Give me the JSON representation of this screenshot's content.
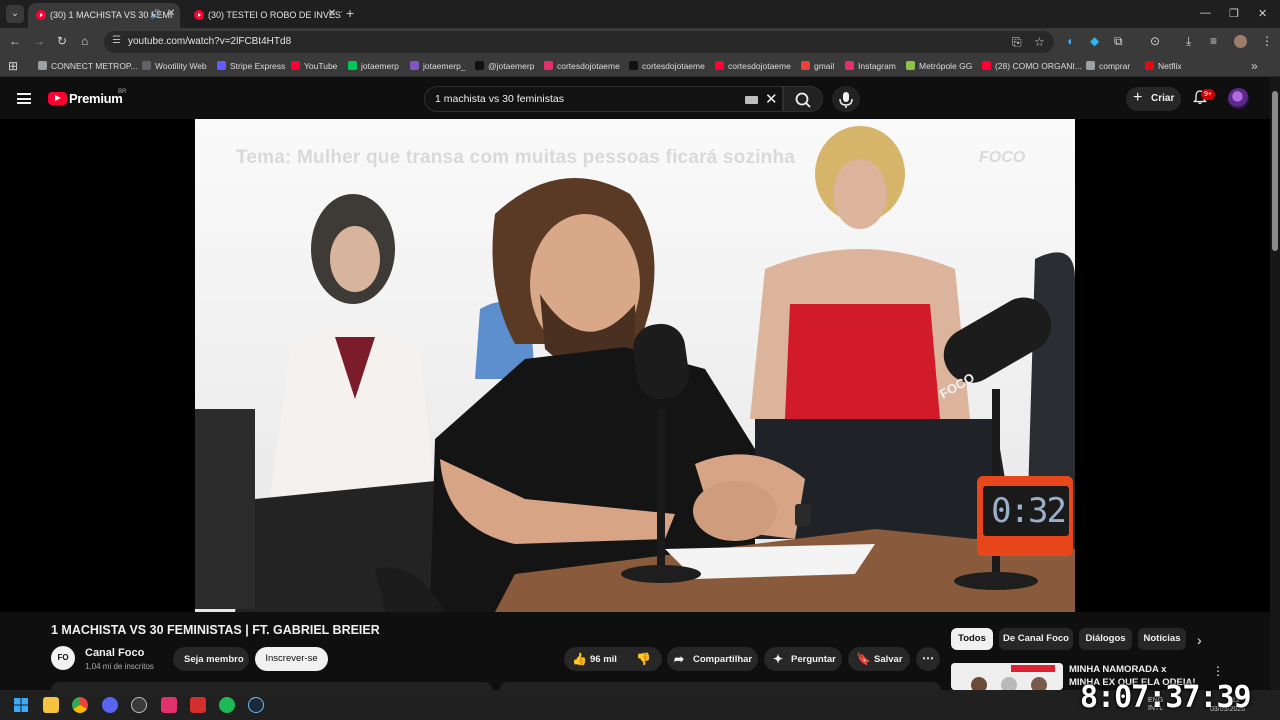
{
  "browser": {
    "tabs": [
      {
        "title": "(30) 1 MACHISTA VS 30 FEMI",
        "active": true
      },
      {
        "title": "(30) TESTEI O ROBO DE INVEST",
        "active": false
      }
    ],
    "url": "youtube.com/watch?v=2lFCBt4HTd8",
    "bookmarks": [
      {
        "label": "CONNECT METROP...",
        "color": "#9aa0a6"
      },
      {
        "label": "Wootility Web",
        "color": "#5f6368"
      },
      {
        "label": "Stripe Express",
        "color": "#635bff"
      },
      {
        "label": "YouTube",
        "color": "#ff0033"
      },
      {
        "label": "jotaemerp",
        "color": "#00c853"
      },
      {
        "label": "jotaemerp_",
        "color": "#7e57c2"
      },
      {
        "label": "@jotaemerp",
        "color": "#111111"
      },
      {
        "label": "cortesdojotaeme",
        "color": "#e1306c"
      },
      {
        "label": "cortesdojotaeme",
        "color": "#111111"
      },
      {
        "label": "cortesdojotaeme",
        "color": "#ff0033"
      },
      {
        "label": "gmail",
        "color": "#ea4335"
      },
      {
        "label": "Instagram",
        "color": "#e1306c"
      },
      {
        "label": "Metrópole GG",
        "color": "#8bc34a"
      },
      {
        "label": "(28) COMO ORGANI...",
        "color": "#ff0033"
      },
      {
        "label": "comprar",
        "color": "#9aa0a6"
      },
      {
        "label": "Netflix",
        "color": "#e50914"
      }
    ]
  },
  "youtube": {
    "logo_text": "Premium",
    "region": "BR",
    "search_query": "1 machista vs 30 feministas",
    "create_label": "Criar",
    "notif_badge": "9+"
  },
  "video": {
    "overlay_text": "Tema: Mulher que transa com muitas pessoas ficará sozinha",
    "overlay_logo": "FOCO",
    "timer": "0:32",
    "title": "1 MACHISTA VS 30 FEMINISTAS | FT. GABRIEL BREIER",
    "channel": "Canal Foco",
    "channel_avatar": "FO",
    "subscribers": "1,04 mi de inscritos",
    "member_label": "Seja membro",
    "subscribe_label": "Inscrever-se",
    "likes": "96 mil",
    "share_label": "Compartilhar",
    "ask_label": "Perguntar",
    "save_label": "Salvar"
  },
  "filters": [
    "Todos",
    "De Canal Foco",
    "Diálogos",
    "Notícias"
  ],
  "recommendation": {
    "title": "MINHA NAMORADA x MINHA EX QUE ELA ODEIA!"
  },
  "taskbar": {
    "clock": "8:07:37:39",
    "lang": "ENG\nINTL",
    "time_small": "12",
    "date": "03/03/2026"
  }
}
